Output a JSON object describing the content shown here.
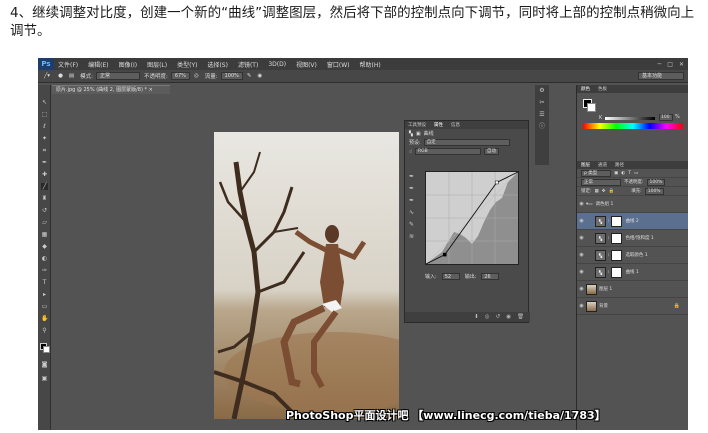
{
  "instruction": "4、继续调整对比度，创建一个新的“曲线”调整图层，然后将下部的控制点向下调节，同时将上部的控制点稍微向上调节。",
  "app": {
    "logo": "Ps",
    "menu": [
      "文件(F)",
      "编辑(E)",
      "图像(I)",
      "图层(L)",
      "类型(Y)",
      "选择(S)",
      "滤镜(T)",
      "3D(D)",
      "视图(V)",
      "窗口(W)",
      "帮助(H)"
    ],
    "window_controls": [
      "─",
      "□",
      "✕"
    ]
  },
  "options": {
    "mode_label": "模式:",
    "mode_value": "正常",
    "opacity_label": "不透明度:",
    "opacity_value": "67%",
    "flow_label": "流量:",
    "flow_value": "100%",
    "workspace": "基本功能"
  },
  "document_tab": "原片.jpg @ 25% (曲线 2, 图层蒙版/8) * ×",
  "curves": {
    "tabs": [
      "工具预设",
      "属性",
      "信息"
    ],
    "title": "曲线",
    "preset_label": "预设:",
    "preset_value": "自定",
    "channel_value": "RGB",
    "auto_button": "自动",
    "input_label": "输入:",
    "input_value": "52",
    "output_label": "输出:",
    "output_value": "26",
    "points": [
      [
        0,
        0
      ],
      [
        52,
        26
      ],
      [
        196,
        226
      ],
      [
        255,
        255
      ]
    ]
  },
  "panels": {
    "color_tabs": [
      "颜色",
      "色板"
    ],
    "k_label": "K",
    "k_value": "100",
    "k_unit": "%",
    "layers_tabs": [
      "图层",
      "通道",
      "路径"
    ],
    "kind_label": "ρ 类型",
    "blend_value": "正常",
    "opacity_label": "不透明度:",
    "opacity_value": "100%",
    "lock_label": "锁定:",
    "fill_label": "填充:",
    "fill_value": "100%",
    "group_name": "调色组 1",
    "layers": [
      {
        "name": "曲线 2",
        "kind": "adjust",
        "selected": true
      },
      {
        "name": "色相/饱和度 1",
        "kind": "adjust",
        "selected": false
      },
      {
        "name": "选取颜色 1",
        "kind": "adjust",
        "selected": false
      },
      {
        "name": "曲线 1",
        "kind": "adjust",
        "selected": false
      },
      {
        "name": "图层 1",
        "kind": "photo",
        "selected": false
      },
      {
        "name": "背景",
        "kind": "photo",
        "selected": false
      }
    ]
  },
  "watermark": "PhotoShop平面设计吧 【www.linecg.com/tieba/1783】"
}
